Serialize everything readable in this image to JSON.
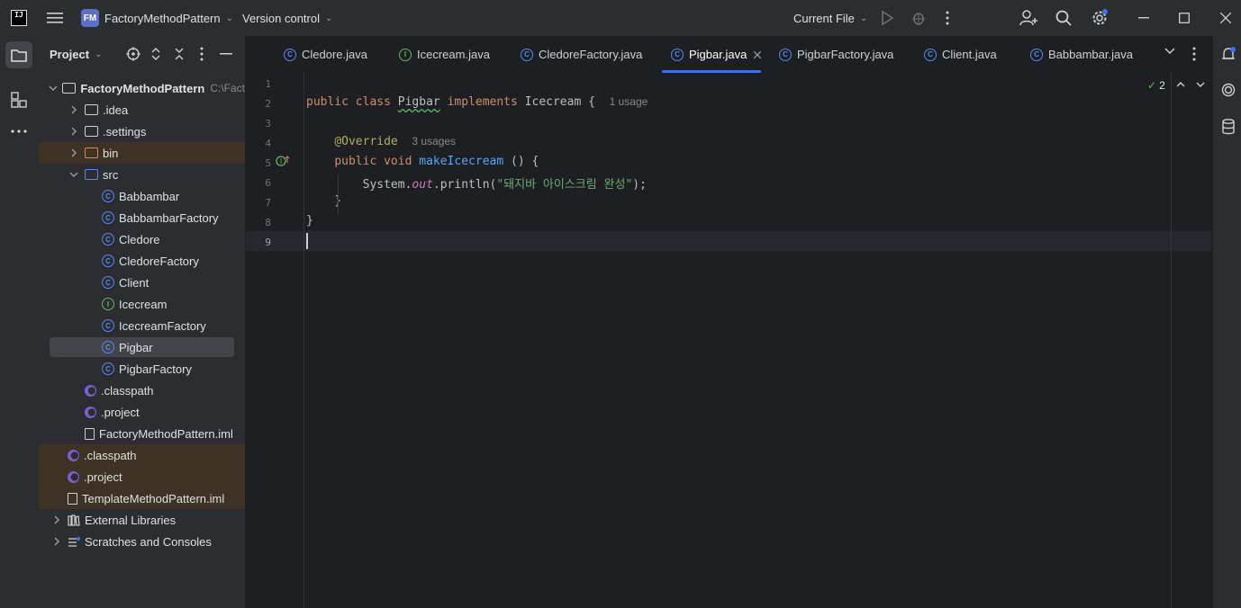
{
  "titlebar": {
    "app_icon": "intellij-logo-icon",
    "project_badge": "FM",
    "project_name": "FactoryMethodPattern",
    "vcs": "Version control",
    "run_config": "Current File"
  },
  "project_panel": {
    "title": "Project",
    "tree": [
      {
        "label": "FactoryMethodPattern",
        "suffix": "C:\\Fact",
        "kind": "module"
      },
      {
        "label": ".idea",
        "kind": "folder"
      },
      {
        "label": ".settings",
        "kind": "folder"
      },
      {
        "label": "bin",
        "kind": "folder-excluded"
      },
      {
        "label": "src",
        "kind": "folder-src"
      },
      {
        "label": "Babbambar",
        "kind": "class"
      },
      {
        "label": "BabbambarFactory",
        "kind": "class"
      },
      {
        "label": "Cledore",
        "kind": "class"
      },
      {
        "label": "CledoreFactory",
        "kind": "class"
      },
      {
        "label": "Client",
        "kind": "class-main"
      },
      {
        "label": "Icecream",
        "kind": "interface"
      },
      {
        "label": "IcecreamFactory",
        "kind": "class-abstract"
      },
      {
        "label": "Pigbar",
        "kind": "class"
      },
      {
        "label": "PigbarFactory",
        "kind": "class"
      },
      {
        "label": ".classpath",
        "kind": "eclipse"
      },
      {
        "label": ".project",
        "kind": "eclipse"
      },
      {
        "label": "FactoryMethodPattern.iml",
        "kind": "file"
      },
      {
        "label": ".classpath",
        "kind": "eclipse-excluded"
      },
      {
        "label": ".project",
        "kind": "eclipse-excluded"
      },
      {
        "label": "TemplateMethodPattern.iml",
        "kind": "file-excluded"
      },
      {
        "label": "External Libraries",
        "kind": "libraries"
      },
      {
        "label": "Scratches and Consoles",
        "kind": "scratches"
      }
    ]
  },
  "tabs": [
    {
      "label": "Cledore.java",
      "kind": "class"
    },
    {
      "label": "Icecream.java",
      "kind": "interface"
    },
    {
      "label": "CledoreFactory.java",
      "kind": "class"
    },
    {
      "label": "Pigbar.java",
      "kind": "class",
      "active": true
    },
    {
      "label": "PigbarFactory.java",
      "kind": "class"
    },
    {
      "label": "Client.java",
      "kind": "class-main"
    },
    {
      "label": "Babbambar.java",
      "kind": "class"
    }
  ],
  "editor": {
    "inspection_count": "2",
    "line_numbers": [
      "1",
      "2",
      "3",
      "4",
      "5",
      "6",
      "7",
      "8",
      "9"
    ],
    "line2": {
      "kw1": "public",
      "kw2": "class",
      "name": "Pigbar",
      "kw3": "implements",
      "iface": "Icecream",
      "brace": "{",
      "hint": "1 usage"
    },
    "line4": {
      "ann": "@Override",
      "hint": "3 usages"
    },
    "line5": {
      "kw1": "public",
      "kw2": "void",
      "fn": "makeIcecream",
      "rest": " () {"
    },
    "line6": {
      "obj": "System.",
      "field": "out",
      "call": ".println(",
      "str": "\"돼지바 아이스크림 완성\"",
      "end": ");"
    },
    "line7": "}",
    "line8": "}"
  }
}
